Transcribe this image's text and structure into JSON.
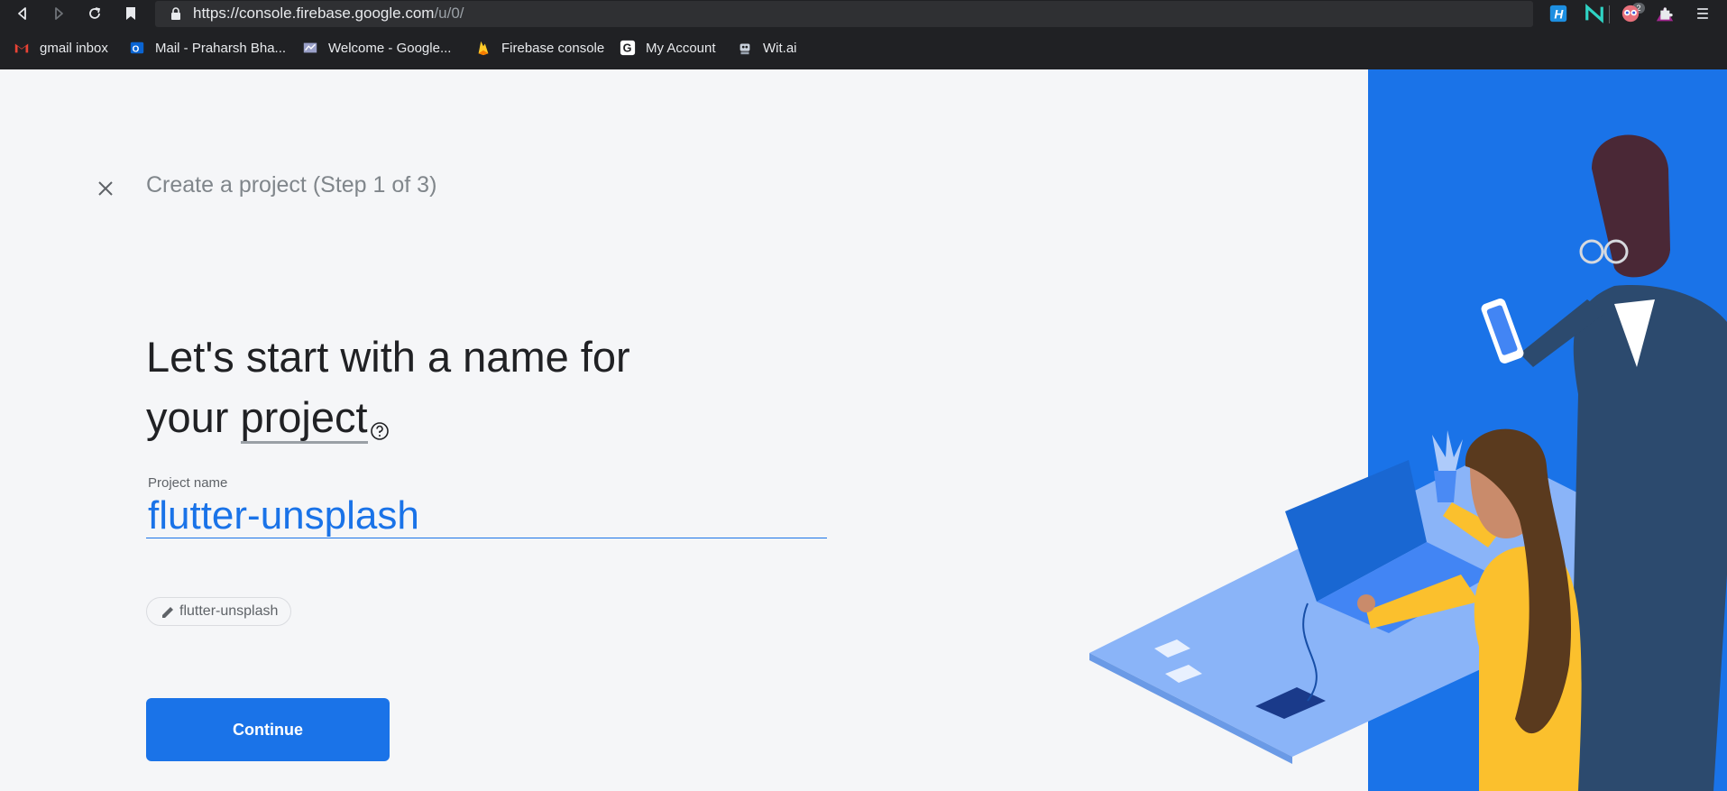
{
  "browser": {
    "url_main": "https://console.firebase.google.com",
    "url_path": "/u/0/",
    "shield_badge": "2",
    "bookmarks": [
      {
        "label": "gmail inbox"
      },
      {
        "label": "Mail - Praharsh Bha..."
      },
      {
        "label": "Welcome - Google..."
      },
      {
        "label": "Firebase console"
      },
      {
        "label": "My Account"
      },
      {
        "label": "Wit.ai"
      }
    ]
  },
  "page": {
    "step_title": "Create a project (Step 1 of 3)",
    "headline_line1": "Let's start with a name for",
    "headline_line2_prefix": "your ",
    "headline_line2_underlined": "project",
    "field_label": "Project name",
    "project_name": "flutter-unsplash",
    "project_id_chip": "flutter-unsplash",
    "continue_label": "Continue"
  },
  "colors": {
    "accent": "#1a73e8",
    "illustration_bg": "#1a73e8",
    "chrome_bg": "#202124"
  }
}
